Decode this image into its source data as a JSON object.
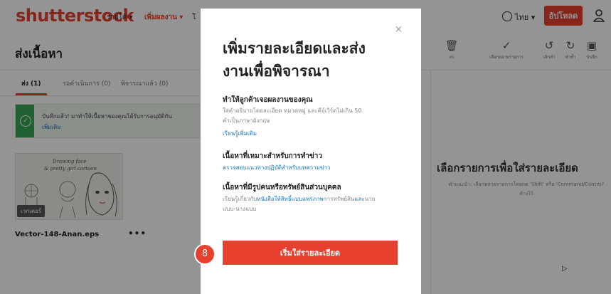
{
  "topbar": {
    "logo_main": "shutterst",
    "logo_o": "o",
    "logo_end": "ck",
    "nav": [
      "รายได้ ▾",
      "เพิ่มผลงาน ▾",
      "โ"
    ],
    "language": "ไทย ▾",
    "upload_label": "อัปโหลด",
    "user_icon": "user-icon"
  },
  "subheader": {
    "title": "ส่งเนื้อหา",
    "tools": [
      {
        "icon": "trash-icon",
        "glyph": "🗑",
        "label": "ลบ"
      },
      {
        "icon": "check-icon",
        "glyph": "✓",
        "label": "เลือกหลายรายการ"
      },
      {
        "icon": "undo-icon",
        "glyph": "↺",
        "label": "เลิกทำ"
      },
      {
        "icon": "redo-icon",
        "glyph": "↻",
        "label": "ทำซ้ำ"
      },
      {
        "icon": "save-icon",
        "glyph": "▣",
        "label": "บันทึก"
      }
    ]
  },
  "tabs": [
    "ส่ง (1)",
    "รอดำเนินการ (0)",
    "พิจารณาแล้ว (0)"
  ],
  "notice": {
    "text": "บันทึกแล้ว! มาทำให้เนื้อหาของคุณได้รับการอนุมัติกัน",
    "link": "เพิ่มเติม"
  },
  "asset": {
    "badge": "เวกเตอร์",
    "file_name": "Vector-148-Anan.eps",
    "more": "•••",
    "sketch_text_1": "Drawing face",
    "sketch_text_2": "& pretty girl cartoon"
  },
  "right_pane": {
    "title": "เลือกรายการเพื่อใส่รายละเอียด",
    "subtitle": "คำแนะนำ: เลือกหลายรายการโดยกด 'Shift' หรือ 'Command/Control' ค้างไว้"
  },
  "modal": {
    "close": "×",
    "title_line1": "เพิ่มรายละเอียดและส่ง",
    "title_line2": "งานเพื่อพิจารณา",
    "section1_heading": "ทำให้ลูกค้าเจอผลงานของคุณ",
    "section1_text_1": "ใส่คำอธิบายโดยละเอียด หมวดหมู่ และคีย์เวิร์ดไม่เกิน 50",
    "section1_text_2": "คำเป็นภาษาอังกฤษ",
    "section1_link": "เรียนรู้เพิ่มเติม",
    "section2_heading": "เนื้อหาที่เหมาะสำหรับการทำข่าว",
    "section2_link": "ตรวจสอบแนวทางปฏิบัติสำหรับบทความข่าว",
    "section3_heading": "เนื้อหาที่มีรูปคนหรือทรัพย์สินส่วนบุคคล",
    "section3_text_pre": "เรียนรู้เกี่ยวกับ",
    "section3_link": "หนังสือให้สิทธิ์แบบแพร่ภาพ",
    "section3_text_mid": "การทรัพย์สิน",
    "section3_link2": "และ",
    "section3_text_post": "นาย",
    "section3_text_line2": "แบบ-นางแบบ",
    "start_button": "เริ่มใส่รายละเอียด",
    "step_number": "8"
  },
  "colors": {
    "brand": "#e8402e",
    "link": "#1a78c2",
    "success": "#3aa655"
  }
}
